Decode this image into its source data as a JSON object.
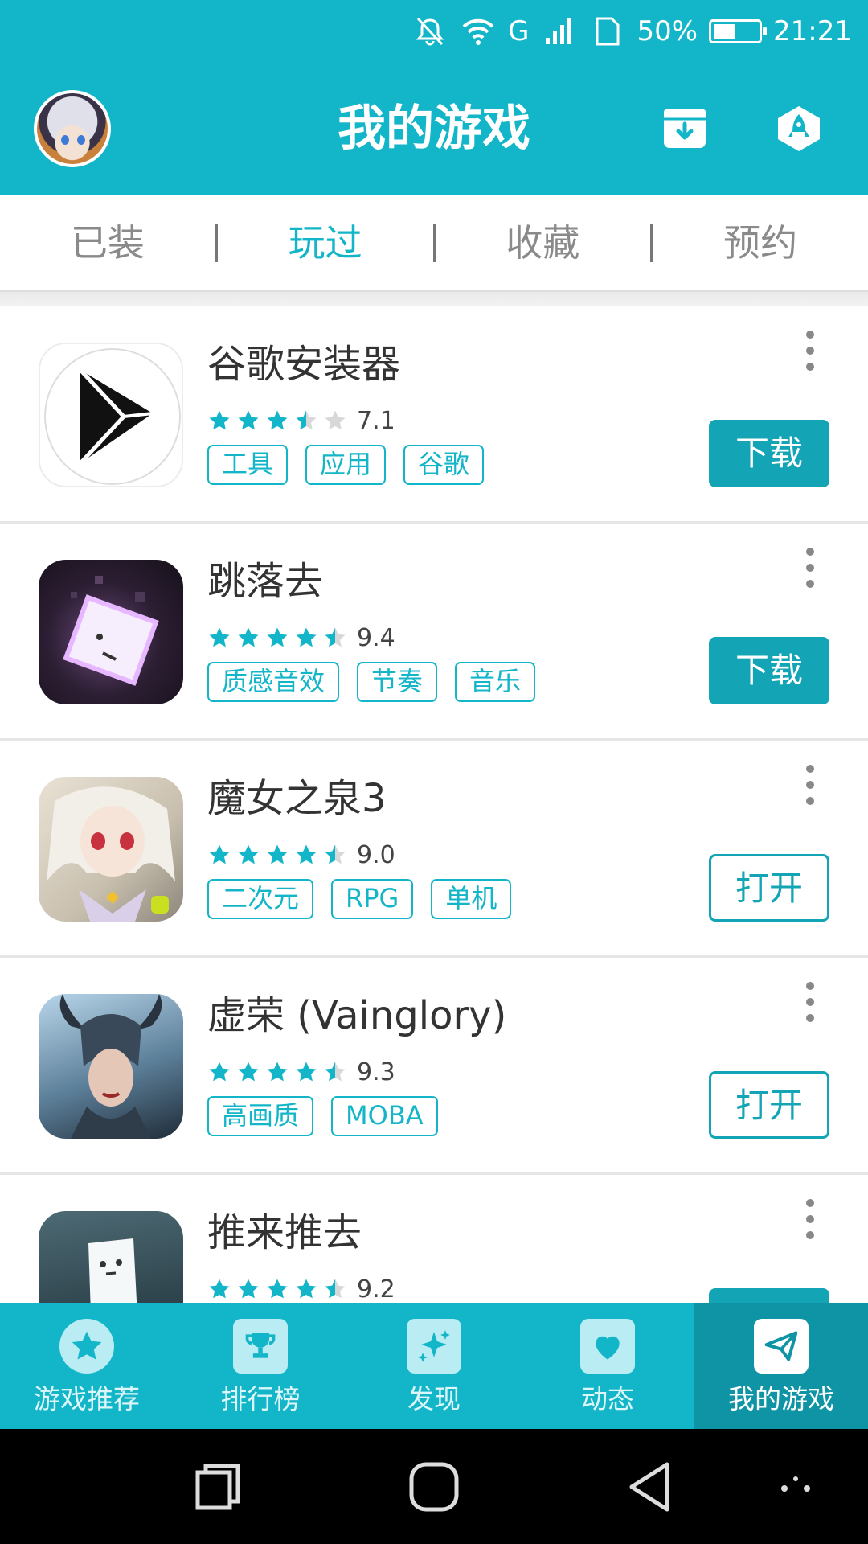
{
  "status_bar": {
    "battery_percent": "50%",
    "battery_level": 0.5,
    "time": "21:21",
    "network": "G",
    "icons": [
      "notifications-off-icon",
      "wifi-icon",
      "signal-icon",
      "sim-icon",
      "battery-icon"
    ]
  },
  "header": {
    "title": "我的游戏",
    "left_icon": "avatar",
    "right_icons": [
      "download-box-icon",
      "rocket-icon"
    ]
  },
  "tabs": [
    {
      "label": "已装",
      "active": false
    },
    {
      "label": "玩过",
      "active": true
    },
    {
      "label": "收藏",
      "active": false
    },
    {
      "label": "预约",
      "active": false
    }
  ],
  "apps": [
    {
      "name": "谷歌安装器",
      "rating": 3.5,
      "score": "7.1",
      "tags": [
        "工具",
        "应用",
        "谷歌"
      ],
      "action": "下载",
      "action_type": "download",
      "icon": "google-play-icon"
    },
    {
      "name": "跳落去",
      "rating": 4.5,
      "score": "9.4",
      "tags": [
        "质感音效",
        "节奏",
        "音乐"
      ],
      "action": "下载",
      "action_type": "download",
      "icon": "glowing-cube-icon"
    },
    {
      "name": "魔女之泉3",
      "rating": 4.5,
      "score": "9.0",
      "tags": [
        "二次元",
        "RPG",
        "单机"
      ],
      "action": "打开",
      "action_type": "open",
      "icon": "anime-girl-icon"
    },
    {
      "name": "虚荣 (Vainglory)",
      "rating": 4.5,
      "score": "9.3",
      "tags": [
        "高画质",
        "MOBA"
      ],
      "action": "打开",
      "action_type": "open",
      "icon": "armored-hero-icon"
    },
    {
      "name": "推来推去",
      "rating": 4.5,
      "score": "9.2",
      "tags": [],
      "action": "",
      "action_type": "download",
      "icon": "white-block-icon"
    }
  ],
  "bottom_nav": [
    {
      "label": "游戏推荐",
      "icon": "star-icon",
      "active": false
    },
    {
      "label": "排行榜",
      "icon": "trophy-icon",
      "active": false
    },
    {
      "label": "发现",
      "icon": "sparkle-icon",
      "active": false
    },
    {
      "label": "动态",
      "icon": "heart-icon",
      "active": false
    },
    {
      "label": "我的游戏",
      "icon": "paper-plane-icon",
      "active": true
    }
  ],
  "system_nav": [
    "recents-icon",
    "home-icon",
    "back-icon",
    "more-icon"
  ],
  "colors": {
    "accent": "#13b5c8",
    "button": "#13a4b6",
    "active_nav": "#0f94a6",
    "star_off": "#d8d8d8"
  }
}
